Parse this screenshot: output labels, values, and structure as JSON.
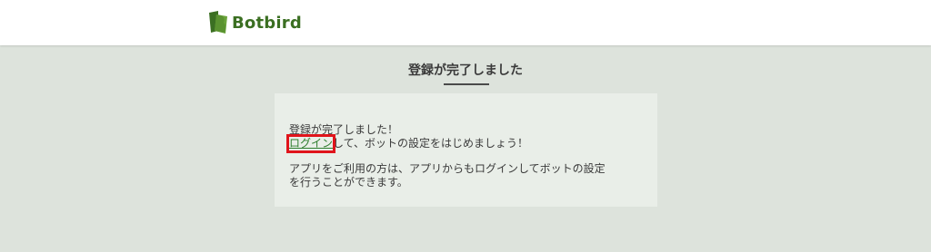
{
  "header": {
    "logo_text": "Botbird",
    "brand_color": "#4a7a2a"
  },
  "main": {
    "title": "登録が完了しました",
    "card": {
      "line1": "登録が完了しました！",
      "login_link": "ログイン",
      "line2_rest": "して、ボットの設定をはじめましょう！",
      "line3": "アプリをご利用の方は、アプリからもログインしてボットの設定",
      "line4": "を行うことができます。"
    }
  },
  "colors": {
    "page_bg": "#dde3dc",
    "card_bg": "#e9eee8",
    "link": "#2e7d2e",
    "highlight": "#e0141b"
  }
}
